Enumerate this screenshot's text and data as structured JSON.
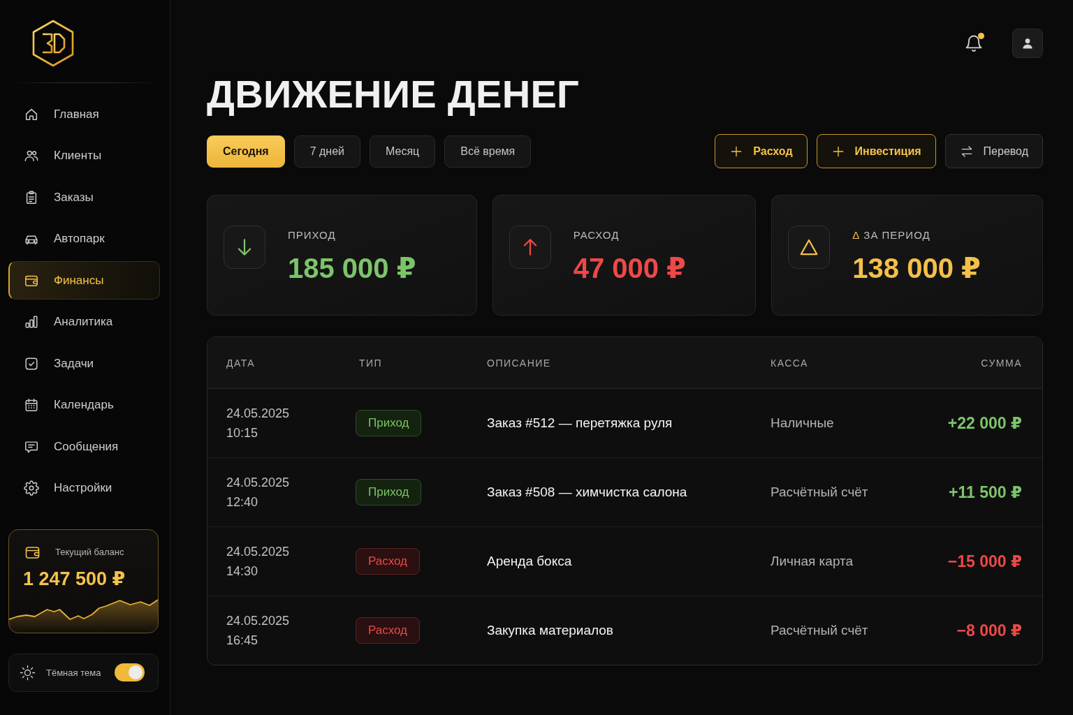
{
  "sidebar": {
    "nav_items": [
      {
        "label": "Главная",
        "selected": false
      },
      {
        "label": "Клиенты",
        "selected": false
      },
      {
        "label": "Заказы",
        "selected": false
      },
      {
        "label": "Автопарк",
        "selected": false
      },
      {
        "label": "Финансы",
        "selected": true
      },
      {
        "label": "Аналитика",
        "selected": false
      },
      {
        "label": "Задачи",
        "selected": false
      },
      {
        "label": "Календарь",
        "selected": false
      },
      {
        "label": "Сообщения",
        "selected": false
      },
      {
        "label": "Настройки",
        "selected": false
      }
    ],
    "balance_card": {
      "label": "Текущий баланс",
      "amount": "1 247 500 ₽"
    },
    "theme_toggle": {
      "label": "Тёмная тема",
      "on": true
    }
  },
  "header": {
    "notifications": {
      "unread": true
    }
  },
  "title": "ДВИЖЕНИЕ ДЕНЕГ",
  "period_tabs": [
    {
      "label": "Сегодня",
      "selected": true
    },
    {
      "label": "7 дней",
      "selected": false
    },
    {
      "label": "Месяц",
      "selected": false
    },
    {
      "label": "Всё время",
      "selected": false
    }
  ],
  "actions": [
    {
      "label": "Расход",
      "kind": "add"
    },
    {
      "label": "Инвестиция",
      "kind": "add"
    },
    {
      "label": "Перевод",
      "kind": "transfer"
    }
  ],
  "summary_cards": [
    {
      "kind": "income",
      "label": "ПРИХОД",
      "value": "185 000 ₽"
    },
    {
      "kind": "expense",
      "label": "РАСХОД",
      "value": "47 000 ₽"
    },
    {
      "kind": "net",
      "prefix": "Δ",
      "label": "ЗА ПЕРИОД",
      "value": "138 000 ₽"
    }
  ],
  "table": {
    "columns": [
      "ДАТА",
      "ТИП",
      "ОПИСАНИЕ",
      "КАССА",
      "СУММА"
    ],
    "rows": [
      {
        "kind": "income",
        "date": "24.05.2025",
        "time": "10:15",
        "type": "Приход",
        "description": "Заказ #512 — перетяжка руля",
        "account": "Наличные",
        "amount": "+22 000 ₽"
      },
      {
        "kind": "income",
        "date": "24.05.2025",
        "time": "12:40",
        "type": "Приход",
        "description": "Заказ #508 — химчистка салона",
        "account": "Расчётный счёт",
        "amount": "+11 500 ₽"
      },
      {
        "kind": "expense",
        "date": "24.05.2025",
        "time": "14:30",
        "type": "Расход",
        "description": "Аренда бокса",
        "account": "Личная карта",
        "amount": "−15 000 ₽"
      },
      {
        "kind": "expense",
        "date": "24.05.2025",
        "time": "16:45",
        "type": "Расход",
        "description": "Закупка материалов",
        "account": "Расчётный счёт",
        "amount": "−8 000 ₽"
      }
    ]
  }
}
